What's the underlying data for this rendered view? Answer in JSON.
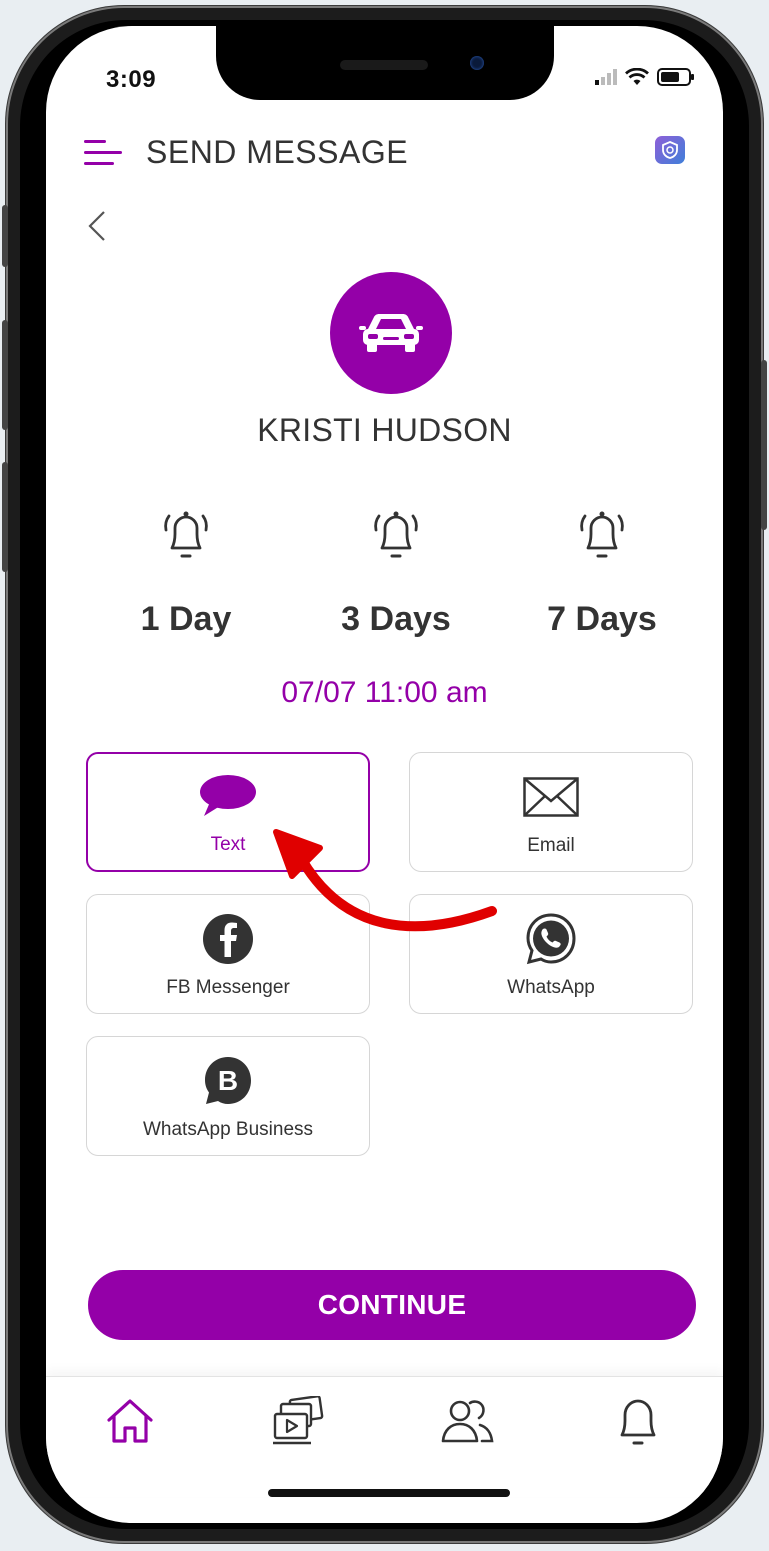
{
  "status_bar": {
    "time": "3:09",
    "icons": [
      "signal-icon",
      "wifi-icon",
      "battery-icon"
    ]
  },
  "header": {
    "title": "SEND MESSAGE",
    "menu_icon": "menu-icon",
    "badge_icon": "app-badge-icon"
  },
  "contact": {
    "name": "KRISTI HUDSON",
    "avatar_icon": "car-icon"
  },
  "reminders": [
    {
      "label": "1 Day",
      "icon": "bell-icon"
    },
    {
      "label": "3 Days",
      "icon": "bell-icon"
    },
    {
      "label": "7 Days",
      "icon": "bell-icon"
    }
  ],
  "datetime": "07/07 11:00 am",
  "channels": [
    {
      "label": "Text",
      "icon": "chat-bubble-icon",
      "selected": true
    },
    {
      "label": "Email",
      "icon": "envelope-icon",
      "selected": false
    },
    {
      "label": "FB Messenger",
      "icon": "facebook-icon",
      "selected": false
    },
    {
      "label": "WhatsApp",
      "icon": "whatsapp-icon",
      "selected": false
    },
    {
      "label": "WhatsApp Business",
      "icon": "whatsapp-business-icon",
      "selected": false
    }
  ],
  "continue_label": "CONTINUE",
  "tabbar": [
    "home-icon",
    "media-icon",
    "contacts-icon",
    "notifications-icon"
  ],
  "colors": {
    "accent": "#9400a8",
    "annotation_arrow": "#e00000"
  }
}
